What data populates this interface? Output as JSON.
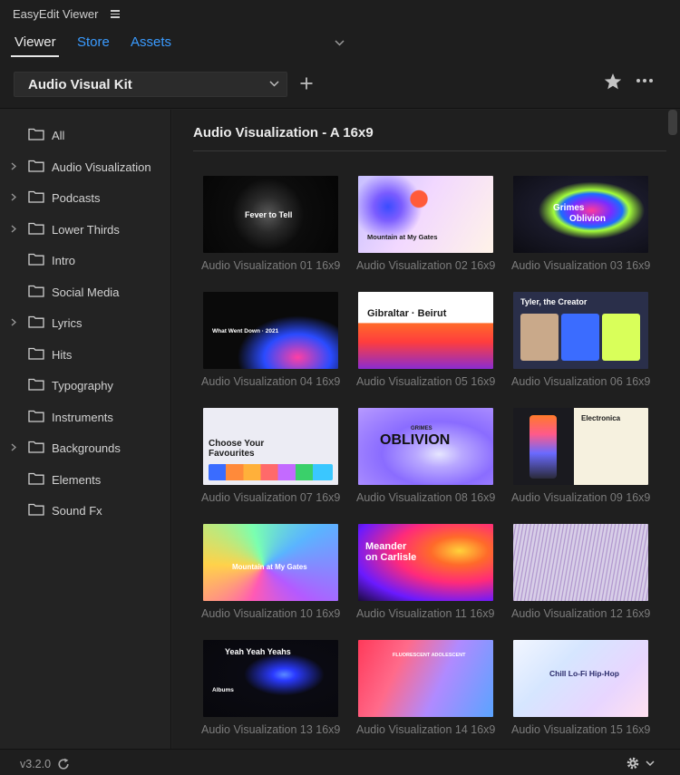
{
  "app": {
    "title": "EasyEdit Viewer"
  },
  "tabs": [
    {
      "label": "Viewer"
    },
    {
      "label": "Store"
    },
    {
      "label": "Assets"
    }
  ],
  "toolbar": {
    "kit_name": "Audio Visual Kit"
  },
  "sidebar": {
    "items": [
      {
        "label": "All"
      },
      {
        "label": "Audio Visualization"
      },
      {
        "label": "Podcasts"
      },
      {
        "label": "Lower Thirds"
      },
      {
        "label": "Intro"
      },
      {
        "label": "Social Media"
      },
      {
        "label": "Lyrics"
      },
      {
        "label": "Hits"
      },
      {
        "label": "Typography"
      },
      {
        "label": "Instruments"
      },
      {
        "label": "Backgrounds"
      },
      {
        "label": "Elements"
      },
      {
        "label": "Sound Fx"
      }
    ]
  },
  "main": {
    "section_title": "Audio Visualization - A 16x9",
    "cards": [
      {
        "caption": "Audio Visualization 01 16x9",
        "text": "Fever to Tell"
      },
      {
        "caption": "Audio Visualization 02 16x9",
        "text": "Mountain at My Gates"
      },
      {
        "caption": "Audio Visualization 03 16x9",
        "text": "Grimes",
        "text2": "Oblivion"
      },
      {
        "caption": "Audio Visualization 04 16x9",
        "text": "What Went Down · 2021"
      },
      {
        "caption": "Audio Visualization 05 16x9",
        "text": "Gibraltar · Beirut"
      },
      {
        "caption": "Audio Visualization 06 16x9",
        "text": "Tyler, the Creator"
      },
      {
        "caption": "Audio Visualization 07 16x9",
        "text": "Choose Your",
        "text2": "Favourites"
      },
      {
        "caption": "Audio Visualization 08 16x9",
        "text": "OBLIVION",
        "text2": "GRIMES"
      },
      {
        "caption": "Audio Visualization 09 16x9",
        "text": "Electronica"
      },
      {
        "caption": "Audio Visualization 10 16x9",
        "text": "Mountain at My Gates"
      },
      {
        "caption": "Audio Visualization 11 16x9",
        "text": "Meander",
        "text2": "on Carlisle"
      },
      {
        "caption": "Audio Visualization 12 16x9",
        "text": ""
      },
      {
        "caption": "Audio Visualization 13 16x9",
        "text": "Yeah Yeah Yeahs",
        "text2": "Albums"
      },
      {
        "caption": "Audio Visualization 14 16x9",
        "text": "FLUORESCENT ADOLESCENT"
      },
      {
        "caption": "Audio Visualization 15 16x9",
        "text": "Chill Lo-Fi Hip-Hop"
      }
    ]
  },
  "footer": {
    "version": "v3.2.0"
  },
  "colors": {
    "accent": "#3a9bff",
    "panel": "#232323",
    "main": "#1f1f1f"
  }
}
